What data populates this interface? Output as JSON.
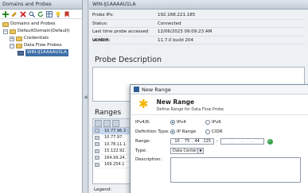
{
  "left_panel": {
    "title": "Domains and Probes",
    "tree": {
      "root": "Domains and Probes",
      "domain": "DefaultDomain(Default)",
      "credentials": "Credentials",
      "probes_folder": "Data Flow Probes",
      "probe": "WIN-IJ1AAAAU1LA"
    }
  },
  "right_panel": {
    "title": "WIN-IJ1AAAAU1LA",
    "properties": [
      {
        "label": "Probe IPs:",
        "value": "192.168.221.185"
      },
      {
        "label": "Status:",
        "value": "Connected"
      },
      {
        "label": "Last time probe accessed UCMDB:",
        "value": "12/06/2023 09:09:23 AM"
      },
      {
        "label": "Version:",
        "value": "11.7.0 build 204"
      }
    ],
    "description_title": "Probe Description",
    "ranges_title": "Ranges",
    "ranges": [
      "10.77.96.3",
      "10.77.97.",
      "10.78.11.1",
      "15.122.92.",
      "164.99.24.",
      "169.254.1"
    ],
    "legend_label": "Legend:"
  },
  "dialog": {
    "window_title": "New Range",
    "title": "New Range",
    "subtitle": "Define Range for Data Flow Probe",
    "ip_version_label": "IPv4/6:",
    "ipv4": "IPv4",
    "ipv6": "IPv6",
    "definition_label": "Definition Type:",
    "ip_range": "IP Range",
    "cidr": "CIDR",
    "range_label": "Range:",
    "range_start": [
      "10",
      "75",
      "44",
      "125"
    ],
    "type_label": "Type:",
    "type_value": "Data Center",
    "description_label": "Description:"
  },
  "colors": {
    "selection": "#3d6fa8",
    "accent": "#f5b400",
    "valid": "#38a049"
  }
}
